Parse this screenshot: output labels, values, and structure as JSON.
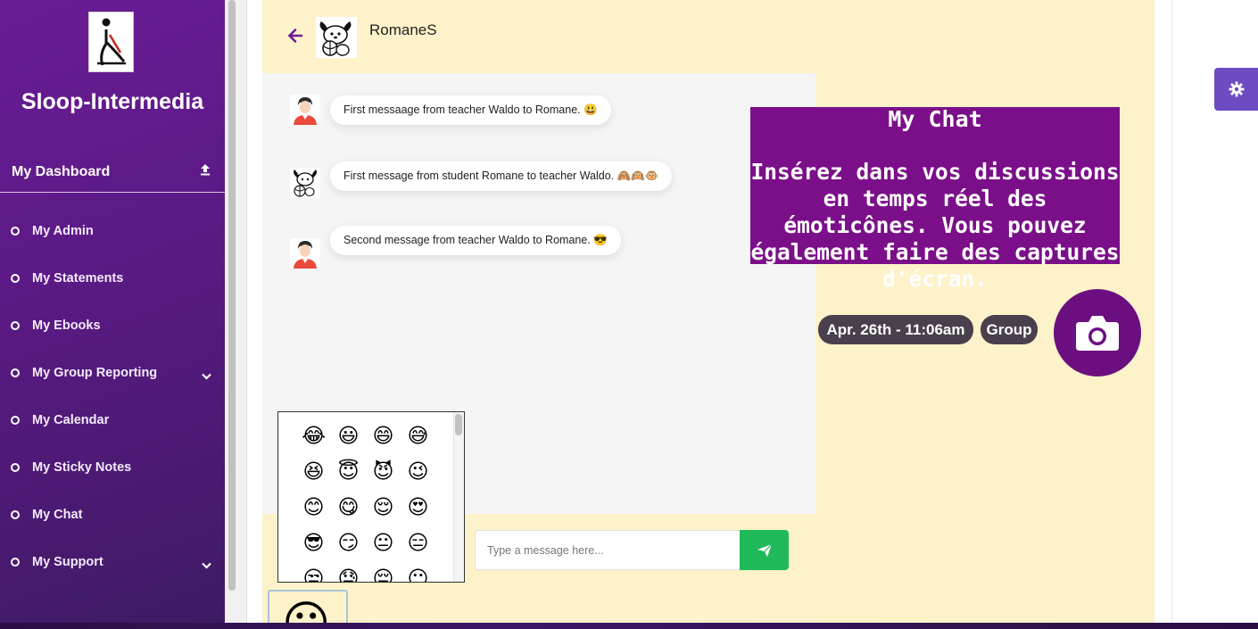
{
  "sidebar": {
    "brand": "Sloop-Intermedia",
    "dashboard_label": "My Dashboard",
    "items": [
      {
        "label": "My Admin",
        "has_submenu": false
      },
      {
        "label": "My Statements",
        "has_submenu": false
      },
      {
        "label": "My Ebooks",
        "has_submenu": false
      },
      {
        "label": "My Group Reporting",
        "has_submenu": true
      },
      {
        "label": "My Calendar",
        "has_submenu": false
      },
      {
        "label": "My Sticky Notes",
        "has_submenu": false
      },
      {
        "label": "My Chat",
        "has_submenu": false
      },
      {
        "label": "My Support",
        "has_submenu": true
      }
    ]
  },
  "chat": {
    "contact_name": "RomaneS",
    "messages": [
      {
        "sender": "teacher",
        "text": "First messaage from teacher Waldo to Romane. 😃"
      },
      {
        "sender": "student",
        "text": "First message from student Romane to teacher Waldo. 🙈🙉🐵"
      },
      {
        "sender": "teacher",
        "text": "Second message from teacher Waldo to Romane. 😎"
      }
    ],
    "input_placeholder": "Type a message here...",
    "send_icon": "paper-plane-icon"
  },
  "emoji_picker": {
    "emojis": [
      "😂",
      "😃",
      "😄",
      "😅",
      "😆",
      "😇",
      "😈",
      "😉",
      "😊",
      "😋",
      "😌",
      "😍",
      "😎",
      "😏",
      "😐",
      "😑",
      "😒",
      "😓",
      "😔",
      "😶"
    ],
    "toggle_emoji": "😶"
  },
  "promo": {
    "title": "My Chat",
    "body": "Insérez dans vos discussions en temps réel des émoticônes. Vous pouvez également faire des captures d'écran."
  },
  "meta_pills": {
    "date": "Apr. 26th - 11:06am",
    "group": "Group"
  },
  "colors": {
    "sidebar": "#5c1a86",
    "panel": "#fdf2c9",
    "promo": "#7b0f89",
    "camera": "#6b0f80",
    "send": "#20b95a",
    "gear": "#6d4bc1",
    "pill": "#4a3f4c"
  }
}
